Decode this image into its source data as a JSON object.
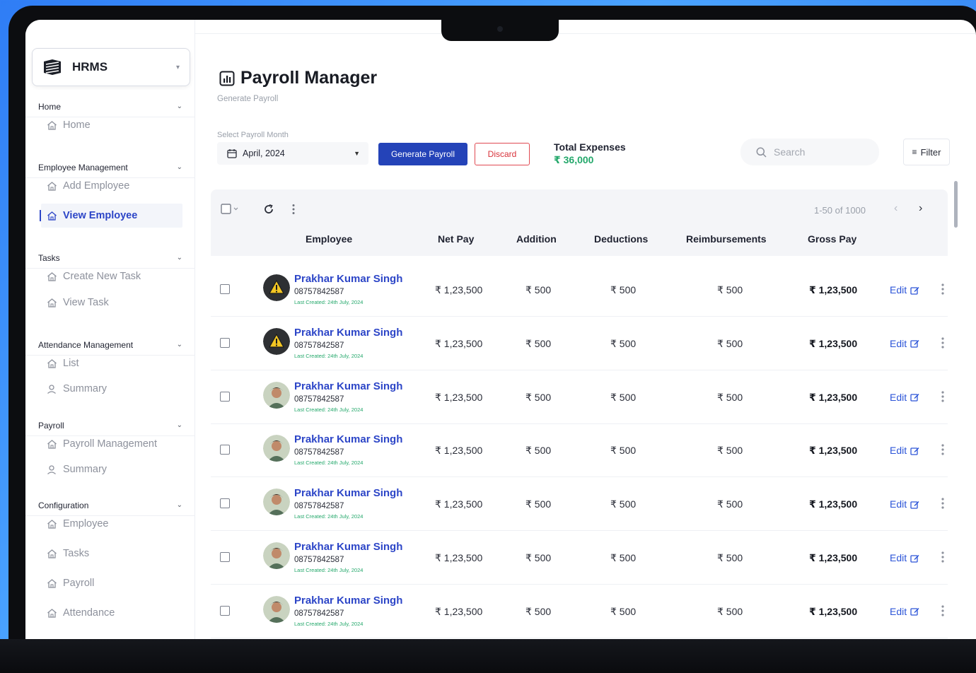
{
  "app": {
    "name": "HRMS"
  },
  "sidebar": {
    "sections": [
      {
        "label": "Home",
        "items": [
          {
            "label": "Home",
            "icon": "home-icon"
          }
        ]
      },
      {
        "label": "Employee Management",
        "items": [
          {
            "label": "Add Employee",
            "icon": "home-icon"
          },
          {
            "label": "View Employee",
            "icon": "home-icon",
            "active": true
          }
        ]
      },
      {
        "label": "Tasks",
        "items": [
          {
            "label": "Create New Task",
            "icon": "home-icon"
          },
          {
            "label": "View Task",
            "icon": "home-icon"
          }
        ]
      },
      {
        "label": "Attendance Management",
        "items": [
          {
            "label": "List",
            "icon": "home-icon"
          },
          {
            "label": "Summary",
            "icon": "user-icon"
          }
        ]
      },
      {
        "label": "Payroll",
        "items": [
          {
            "label": "Payroll Management",
            "icon": "home-icon"
          },
          {
            "label": "Summary",
            "icon": "user-icon"
          }
        ]
      },
      {
        "label": "Configuration",
        "items": [
          {
            "label": "Employee",
            "icon": "home-icon"
          },
          {
            "label": "Tasks",
            "icon": "home-icon"
          },
          {
            "label": "Payroll",
            "icon": "home-icon"
          },
          {
            "label": "Attendance",
            "icon": "home-icon"
          }
        ]
      }
    ]
  },
  "page": {
    "title": "Payroll Manager",
    "subtitle": "Generate Payroll",
    "month_label": "Select Payroll Month",
    "month_value": "April, 2024",
    "generate_label": "Generate Payroll",
    "discard_label": "Discard",
    "expenses_label": "Total Expenses",
    "expenses_value": "₹ 36,000",
    "search_placeholder": "Search",
    "filter_label": "Filter"
  },
  "table": {
    "pagination": "1-50 of 1000",
    "columns": [
      "Employee",
      "Net Pay",
      "Addition",
      "Deductions",
      "Reimbursements",
      "Gross Pay"
    ],
    "edit_label": "Edit",
    "rows": [
      {
        "name": "Prakhar Kumar Singh",
        "phone": "08757842587",
        "meta": "Last Created: 24th July, 2024",
        "net": "₹ 1,23,500",
        "add": "₹ 500",
        "ded": "₹ 500",
        "reimb": "₹ 500",
        "gross": "₹ 1,23,500",
        "avatar": "warning"
      },
      {
        "name": "Prakhar Kumar Singh",
        "phone": "08757842587",
        "meta": "Last Created: 24th July, 2024",
        "net": "₹ 1,23,500",
        "add": "₹ 500",
        "ded": "₹ 500",
        "reimb": "₹ 500",
        "gross": "₹ 1,23,500",
        "avatar": "warning"
      },
      {
        "name": "Prakhar Kumar Singh",
        "phone": "08757842587",
        "meta": "Last Created: 24th July, 2024",
        "net": "₹ 1,23,500",
        "add": "₹ 500",
        "ded": "₹ 500",
        "reimb": "₹ 500",
        "gross": "₹ 1,23,500",
        "avatar": "photo"
      },
      {
        "name": "Prakhar Kumar Singh",
        "phone": "08757842587",
        "meta": "Last Created: 24th July, 2024",
        "net": "₹ 1,23,500",
        "add": "₹ 500",
        "ded": "₹ 500",
        "reimb": "₹ 500",
        "gross": "₹ 1,23,500",
        "avatar": "photo"
      },
      {
        "name": "Prakhar Kumar Singh",
        "phone": "08757842587",
        "meta": "Last Created: 24th July, 2024",
        "net": "₹ 1,23,500",
        "add": "₹ 500",
        "ded": "₹ 500",
        "reimb": "₹ 500",
        "gross": "₹ 1,23,500",
        "avatar": "photo"
      },
      {
        "name": "Prakhar Kumar Singh",
        "phone": "08757842587",
        "meta": "Last Created: 24th July, 2024",
        "net": "₹ 1,23,500",
        "add": "₹ 500",
        "ded": "₹ 500",
        "reimb": "₹ 500",
        "gross": "₹ 1,23,500",
        "avatar": "photo"
      },
      {
        "name": "Prakhar Kumar Singh",
        "phone": "08757842587",
        "meta": "Last Created: 24th July, 2024",
        "net": "₹ 1,23,500",
        "add": "₹ 500",
        "ded": "₹ 500",
        "reimb": "₹ 500",
        "gross": "₹ 1,23,500",
        "avatar": "photo"
      }
    ]
  },
  "colors": {
    "primary": "#2443b8",
    "link": "#2c45c7",
    "success": "#24a86b",
    "danger": "#e04a52"
  }
}
